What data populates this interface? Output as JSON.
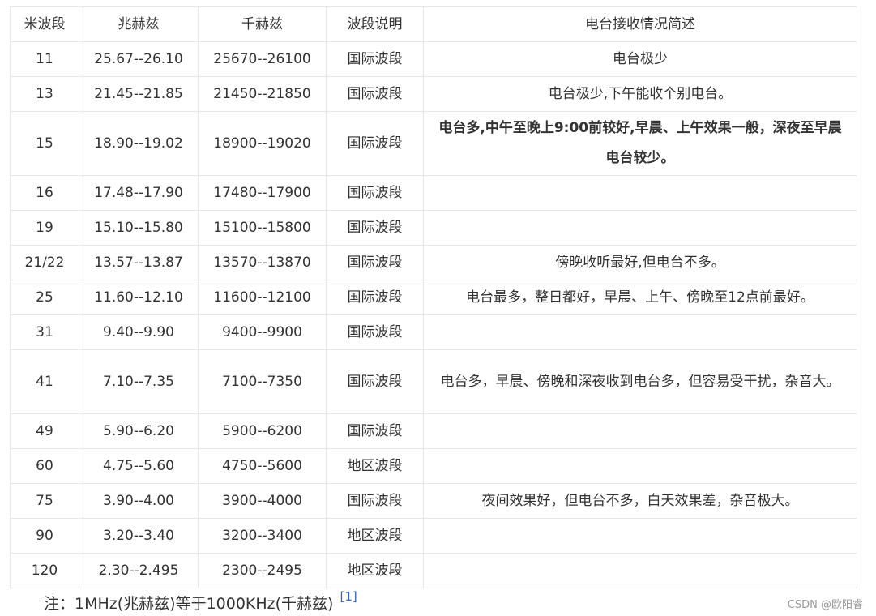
{
  "table": {
    "header": [
      "米波段",
      "兆赫兹",
      "千赫兹",
      "波段说明",
      "电台接收情况简述"
    ],
    "rows": [
      {
        "m": "11",
        "mhz": "25.67--26.10",
        "khz": "25670--26100",
        "type": "国际波段",
        "desc": "电台极少",
        "bold": false,
        "tall": false
      },
      {
        "m": "13",
        "mhz": "21.45--21.85",
        "khz": "21450--21850",
        "type": "国际波段",
        "desc": "电台极少,下午能收个别电台。",
        "bold": false,
        "tall": false
      },
      {
        "m": "15",
        "mhz": "18.90--19.02",
        "khz": "18900--19020",
        "type": "国际波段",
        "desc": "电台多,中午至晚上9:00前较好,早晨、上午效果一般，深夜至早晨电台较少。",
        "bold": true,
        "tall": true
      },
      {
        "m": "16",
        "mhz": "17.48--17.90",
        "khz": "17480--17900",
        "type": "国际波段",
        "desc": "",
        "bold": false,
        "tall": false
      },
      {
        "m": "19",
        "mhz": "15.10--15.80",
        "khz": "15100--15800",
        "type": "国际波段",
        "desc": "",
        "bold": false,
        "tall": false
      },
      {
        "m": "21/22",
        "mhz": "13.57--13.87",
        "khz": "13570--13870",
        "type": "国际波段",
        "desc": "傍晚收听最好,但电台不多。",
        "bold": false,
        "tall": false
      },
      {
        "m": "25",
        "mhz": "11.60--12.10",
        "khz": "11600--12100",
        "type": "国际波段",
        "desc": "电台最多，整日都好，早晨、上午、傍晚至12点前最好。",
        "bold": false,
        "tall": false
      },
      {
        "m": "31",
        "mhz": "9.40--9.90",
        "khz": "9400--9900",
        "type": "国际波段",
        "desc": "",
        "bold": false,
        "tall": false
      },
      {
        "m": "41",
        "mhz": "7.10--7.35",
        "khz": "7100--7350",
        "type": "国际波段",
        "desc": "电台多，早晨、傍晚和深夜收到电台多，但容易受干扰，杂音大。",
        "bold": false,
        "tall": true
      },
      {
        "m": "49",
        "mhz": "5.90--6.20",
        "khz": "5900--6200",
        "type": "国际波段",
        "desc": "",
        "bold": false,
        "tall": false
      },
      {
        "m": "60",
        "mhz": "4.75--5.60",
        "khz": "4750--5600",
        "type": "地区波段",
        "desc": "",
        "bold": false,
        "tall": false
      },
      {
        "m": "75",
        "mhz": "3.90--4.00",
        "khz": "3900--4000",
        "type": "国际波段",
        "desc": "夜间效果好，但电台不多，白天效果差，杂音极大。",
        "bold": false,
        "tall": false
      },
      {
        "m": "90",
        "mhz": "3.20--3.40",
        "khz": "3200--3400",
        "type": "地区波段",
        "desc": "",
        "bold": false,
        "tall": false
      },
      {
        "m": "120",
        "mhz": "2.30--2.495",
        "khz": "2300--2495",
        "type": "地区波段",
        "desc": "",
        "bold": false,
        "tall": false
      }
    ]
  },
  "footnote": {
    "text": "注：1MHz(兆赫兹)等于1000KHz(千赫兹)",
    "ref": "[1]"
  },
  "watermark": "CSDN @欧阳睿",
  "colors": {
    "border": "#e6e6e6",
    "text": "#333333",
    "link": "#3366cc",
    "watermark": "#999999"
  }
}
